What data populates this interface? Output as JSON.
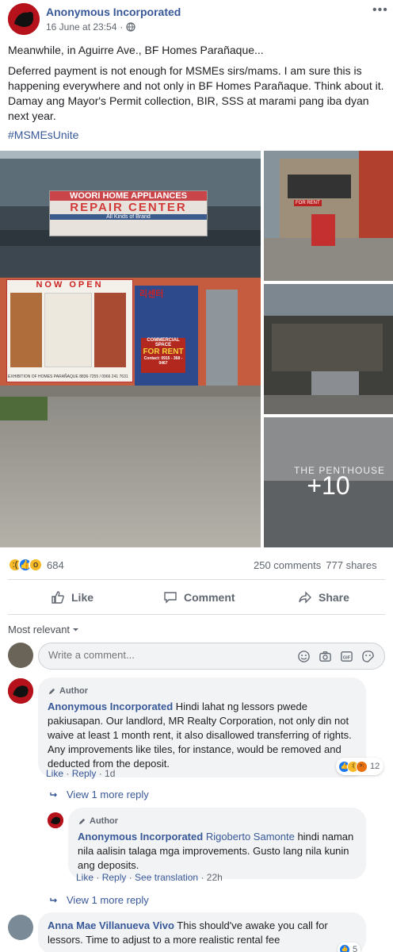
{
  "post": {
    "author": "Anonymous Incorporated",
    "timestamp": "16 June at 23:54",
    "privacy_icon": "globe-icon",
    "more_icon": "more-dots-icon",
    "paragraph1": "Meanwhile, in Aguirre Ave., BF Homes Parañaque...",
    "paragraph2": "Deferred payment is not enough for MSMEs sirs/mams. I am sure this is happening everywhere and not only in BF Homes Parañaque. Think about it. Damay ang Mayor's Permit collection, BIR, SSS at marami pang iba dyan next year.",
    "hashtag": "#MSMEsUnite"
  },
  "photos": {
    "main_sign_top": "WOORI HOME APPLIANCES",
    "main_sign_mid": "REPAIR CENTER",
    "main_sign_small": "All Kinds of Brand",
    "now_open": "NOW OPEN",
    "korean": "리센터",
    "for_rent_1": "COMMERCIAL SPACE",
    "for_rent_2": "FOR RENT",
    "for_rent_3": "Contact: 0915 - 368 - 0467",
    "banner_footer": "EXHIBITION OF HOMES PARAÑAQUE 8836-7255 / 0966 241 7631",
    "side_sign_for_rent": "FOR RENT",
    "penthouse": "THE PENTHOUSE",
    "more_count": "+10"
  },
  "reactions": {
    "count": "684",
    "comments": "250 comments",
    "shares": "777 shares",
    "icons": [
      "sad-emoji-icon",
      "like-icon",
      "wow-emoji-icon"
    ]
  },
  "actions": {
    "like": "Like",
    "comment": "Comment",
    "share": "Share"
  },
  "sort": {
    "label": "Most relevant"
  },
  "composer": {
    "placeholder": "Write a comment...",
    "icons": [
      "emoji-icon",
      "camera-icon",
      "gif-icon",
      "sticker-icon"
    ]
  },
  "comments": [
    {
      "badge": "Author",
      "name": "Anonymous Incorporated",
      "text": " Hindi lahat ng lessors pwede pakiusapan. Our landlord, MR Realty Corporation, not only din not waive at least 1 month rent, it also disallowed transferring of rights. Any improvements like tiles, for instance, would be removed and deducted from the deposit.",
      "like": "Like",
      "reply": "Reply",
      "time": "1d",
      "reaction_count": "12",
      "view_more": "View 1 more reply"
    },
    {
      "badge": "Author",
      "name": "Anonymous Incorporated",
      "mention": "Rigoberto Samonte",
      "text": " hindi naman nila aalisin talaga mga improvements. Gusto lang nila kunin ang deposits.",
      "like": "Like",
      "reply": "Reply",
      "see_translation": "See translation",
      "time": "22h",
      "view_more": "View 1 more reply"
    },
    {
      "name": "Anna Mae Villanueva Vivo",
      "text": " This should've awake you call for lessors. Time to adjust to a more realistic rental fee",
      "reaction_count": "5"
    }
  ],
  "colors": {
    "link": "#385898",
    "muted": "#606770",
    "bubble": "#f2f3f5",
    "border": "#dadde1",
    "like_blue": "#1877f2"
  }
}
